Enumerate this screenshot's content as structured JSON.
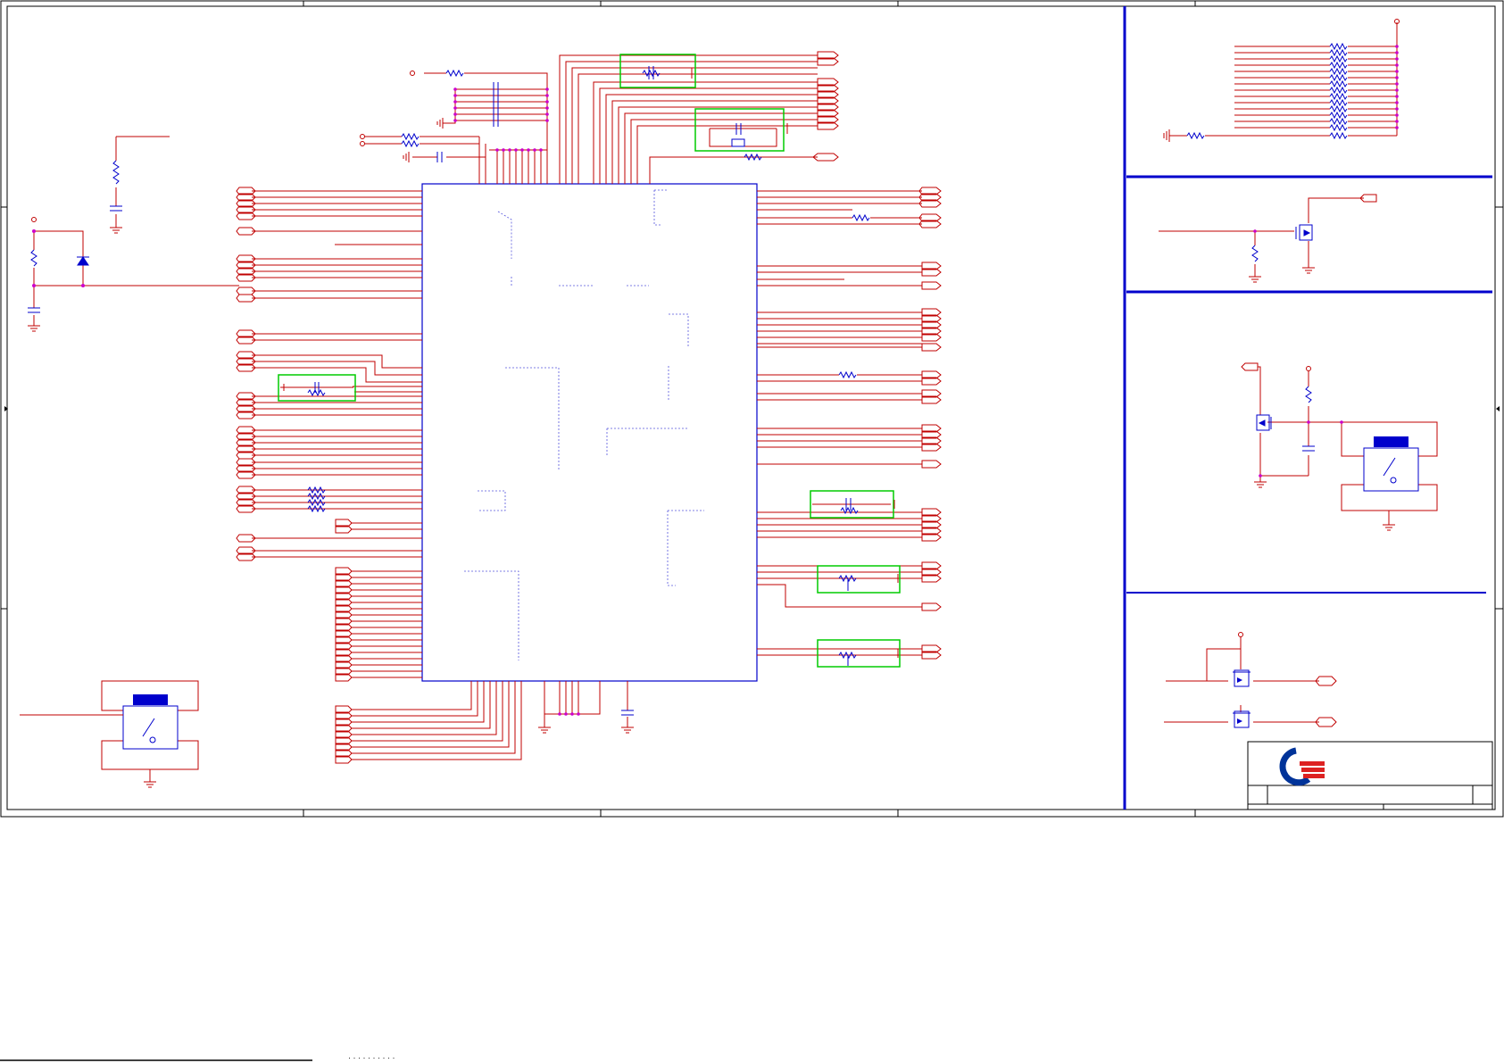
{
  "sheet": {
    "ink_colors": {
      "wire": "#c00000",
      "bus": "#7a0000",
      "component": "#0000cc",
      "frame": "#000000",
      "highlight": "#00cc00",
      "junction": "#cc00cc"
    },
    "regions": [
      "main-schematic",
      "resistor-array-block",
      "mosfet-switch-block",
      "mosfet-relay-block",
      "dual-mosfet-block"
    ],
    "components": {
      "main_ic": "integrated-circuit",
      "left_relay": "relay",
      "right_relay": "relay",
      "logo": "company-logo"
    }
  },
  "footnote": {
    "text": "· · · · · · · · · ·"
  }
}
